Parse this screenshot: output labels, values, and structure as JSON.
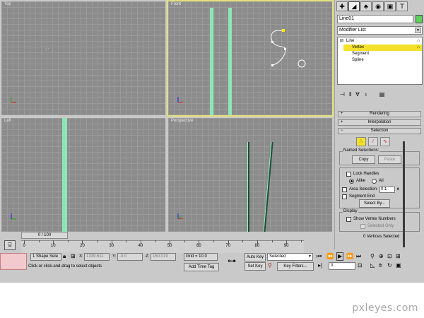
{
  "viewports": {
    "top": {
      "label": "Top"
    },
    "front": {
      "label": "Front"
    },
    "left": {
      "label": "Left"
    },
    "perspective": {
      "label": "Perspective"
    }
  },
  "command_panel": {
    "tabs": [
      "create-icon",
      "modify-icon",
      "hierarchy-icon",
      "motion-icon",
      "display-icon",
      "utilities-icon"
    ],
    "object_name": "Line01",
    "object_color": "#5ed15e",
    "modifier_list": "Modifier List",
    "stack": {
      "root": "Line",
      "sub": [
        "Vertex",
        "Segment",
        "Spline"
      ],
      "selected": "Vertex"
    },
    "rollouts": {
      "rendering": "Rendering",
      "interpolation": "Interpolation",
      "selection": "Selection"
    },
    "named_selections": {
      "title": "Named Selections:",
      "copy": "Copy",
      "paste": "Paste"
    },
    "lock_handles": "Lock Handles",
    "alike": "Alike",
    "all": "All",
    "area_selection": "Area Selection:",
    "area_value": "0.1",
    "segment_end": "Segment End",
    "select_by": "Select By...",
    "display": {
      "title": "Display",
      "show_vertex_numbers": "Show Vertex Numbers",
      "selected_only": "Selected Only"
    },
    "vertices_selected": "0 Vertices Selected"
  },
  "timeline": {
    "slider": "0 / 100",
    "ticks": [
      "0",
      "10",
      "20",
      "30",
      "40",
      "50",
      "60",
      "70",
      "80",
      "90"
    ]
  },
  "status": {
    "selection": "1 Shape Sele",
    "x_label": "X:",
    "x_value": "1339.611",
    "y_label": "Y:",
    "y_value": "-0.0",
    "z_label": "Z:",
    "z_value": "150.019",
    "grid": "Grid = 10.0",
    "prompt": "Click or click-and-drag to select objects",
    "add_time_tag": "Add Time Tag",
    "auto_key": "Auto Key",
    "auto_key_mode": "Selected",
    "set_key": "Set Key",
    "key_filters": "Key Filters...",
    "frame": "0"
  },
  "colors": {
    "selection": "#f3e12a",
    "pillar": "#8ee6b6",
    "active_border": "#e3e07a"
  },
  "watermark": "pxleyes.com"
}
